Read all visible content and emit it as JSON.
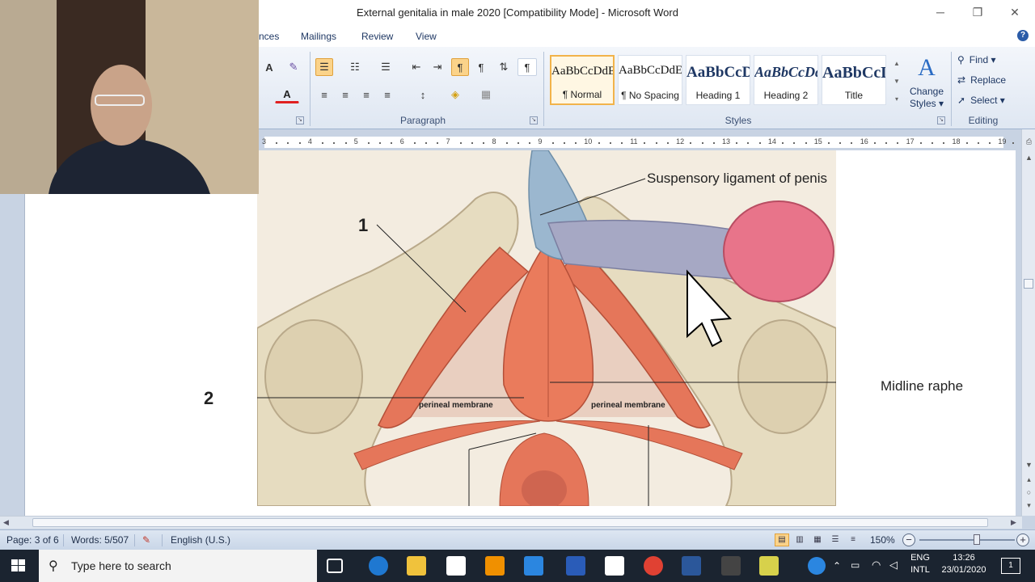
{
  "window": {
    "title": "External genitalia in male 2020 [Compatibility Mode] - Microsoft Word",
    "minimize": "─",
    "restore": "❐",
    "close": "✕"
  },
  "ribbon": {
    "tabs": [
      "nces",
      "Mailings",
      "Review",
      "View"
    ],
    "help": "?",
    "groups": {
      "paragraph": "Paragraph",
      "styles": "Styles",
      "editing": "Editing"
    },
    "font_buttons": {
      "grow": "A",
      "font_color": "A"
    },
    "paragraph_buttons": {
      "bullets": "☰",
      "numbering": "☷",
      "multilevel": "☰",
      "decrease_indent": "⇤",
      "increase_indent": "⇥",
      "ltr": "¶",
      "rtl": "¶",
      "sort": "⇅",
      "show_marks": "¶",
      "align_left": "≡",
      "center": "≡",
      "align_right": "≡",
      "justify": "≡",
      "line_spacing": "↕",
      "shading": "◈",
      "borders": "▦"
    },
    "styles": [
      {
        "preview": "AaBbCcDdEe",
        "label": "¶ Normal",
        "selected": true
      },
      {
        "preview": "AaBbCcDdEe",
        "label": "¶ No Spacing",
        "selected": false
      },
      {
        "preview": "AaBbCcDdEe",
        "label": "Heading 1",
        "selected": false
      },
      {
        "preview": "AaBbCcDdEe",
        "label": "Heading 2",
        "selected": false
      },
      {
        "preview": "AaBbCcDdEe",
        "label": "Title",
        "selected": false
      }
    ],
    "change_styles": {
      "line1": "Change",
      "line2": "Styles ▾",
      "icon": "A"
    },
    "editing": {
      "find": "Find ▾",
      "replace": "Replace",
      "select": "Select ▾"
    }
  },
  "ruler": {
    "numbers": [
      "3",
      "4",
      "5",
      "6",
      "7",
      "8",
      "9",
      "10",
      "11",
      "12",
      "13",
      "14",
      "15",
      "16",
      "17",
      "18",
      "19"
    ]
  },
  "document": {
    "figure_labels": {
      "suspensory": "Suspensory ligament of penis",
      "one": "1",
      "two": "2",
      "midline": "Midline raphe",
      "perineal_left": "perineal membrane",
      "perineal_right": "perineal membrane"
    },
    "colors": {
      "bone": "#e6dcc0",
      "muscle": "#e5765a",
      "penis_shaft": "#a6a8c4",
      "glans": "#e8748a",
      "ligament": "#9bb7cf"
    }
  },
  "statusbar": {
    "page": "Page: 3 of 6",
    "words": "Words: 5/507",
    "language": "English (U.S.)",
    "zoom": "150%",
    "zoom_out": "−",
    "zoom_in": "+",
    "zoom_level": 0.62
  },
  "taskbar": {
    "search_placeholder": "Type here to search",
    "lang": "ENG",
    "layout": "INTL",
    "time": "13:26",
    "date": "23/01/2020",
    "notifications": "1"
  }
}
